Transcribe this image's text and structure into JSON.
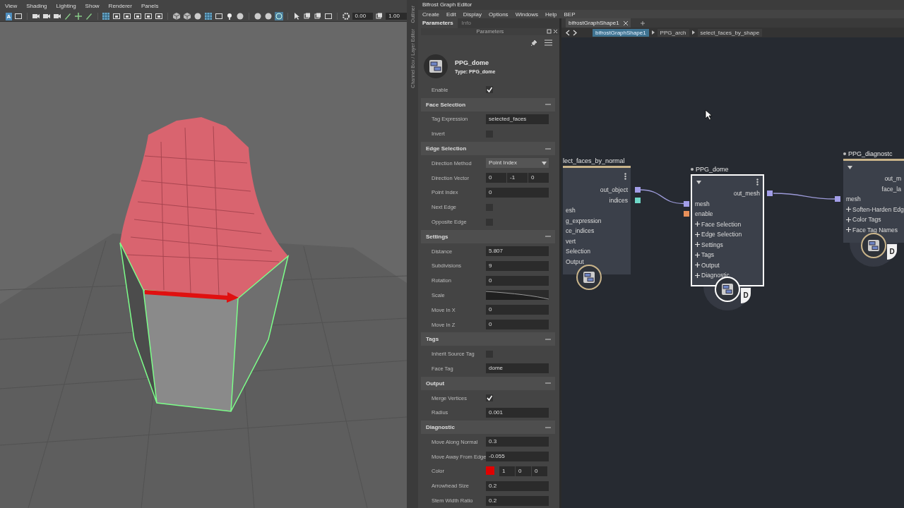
{
  "viewport": {
    "menu": [
      "View",
      "Shading",
      "Lighting",
      "Show",
      "Renderer",
      "Panels"
    ],
    "select_label": "A",
    "toolbar_fields": [
      {
        "value": "0.00"
      },
      {
        "value": "1.00"
      }
    ],
    "picture": {
      "kind": "picture"
    }
  },
  "side_tabs": [
    "Outliner",
    "Channel Box / Layer Editor"
  ],
  "editor": {
    "title": "Bifrost Graph Editor",
    "menu": [
      "Create",
      "Edit",
      "Display",
      "Options",
      "Windows",
      "Help",
      "BEP"
    ],
    "parameters_panel": {
      "tabs": [
        {
          "label": "Parameters",
          "selected": true
        },
        {
          "label": "Info",
          "selected": false
        }
      ],
      "header": "Parameters",
      "node_name": "PPG_dome",
      "node_type": "Type: PPG_dome",
      "rows": [
        {
          "kind": "checkbox",
          "label": "Enable",
          "checked": true
        },
        {
          "kind": "section",
          "label": "Face Selection",
          "expanded": true
        },
        {
          "kind": "text",
          "label": "Tag Expression",
          "value": "selected_faces"
        },
        {
          "kind": "checkbox",
          "label": "Invert",
          "checked": false
        },
        {
          "kind": "section",
          "label": "Edge Selection",
          "expanded": true
        },
        {
          "kind": "dropdown",
          "label": "Direction Method",
          "value": "Point Index"
        },
        {
          "kind": "vector",
          "label": "Direction Vector",
          "values": [
            "0",
            "-1",
            "0"
          ]
        },
        {
          "kind": "text",
          "label": "Point Index",
          "value": "0"
        },
        {
          "kind": "checkbox",
          "label": "Next Edge",
          "checked": false
        },
        {
          "kind": "checkbox",
          "label": "Opposite Edge",
          "checked": false
        },
        {
          "kind": "section",
          "label": "Settings",
          "expanded": true
        },
        {
          "kind": "text",
          "label": "Distance",
          "value": "5.807"
        },
        {
          "kind": "text",
          "label": "Subdivisions",
          "value": "9"
        },
        {
          "kind": "text",
          "label": "Rotation",
          "value": "0"
        },
        {
          "kind": "ramp",
          "label": "Scale"
        },
        {
          "kind": "text",
          "label": "Move In X",
          "value": "0"
        },
        {
          "kind": "text",
          "label": "Move In Z",
          "value": "0"
        },
        {
          "kind": "section",
          "label": "Tags",
          "expanded": true
        },
        {
          "kind": "checkbox",
          "label": "Inherit Source Tag",
          "checked": false
        },
        {
          "kind": "text",
          "label": "Face Tag",
          "value": "dome"
        },
        {
          "kind": "section",
          "label": "Output",
          "expanded": true
        },
        {
          "kind": "checkbox",
          "label": "Merge Vertices",
          "checked": true
        },
        {
          "kind": "text",
          "label": "Radius",
          "value": "0.001"
        },
        {
          "kind": "section",
          "label": "Diagnostic",
          "expanded": true
        },
        {
          "kind": "text",
          "label": "Move Along Normal",
          "value": "0.3"
        },
        {
          "kind": "text",
          "label": "Move Away From Edge",
          "value": "-0.055"
        },
        {
          "kind": "color",
          "label": "Color",
          "color": "#e00000",
          "values": [
            "1",
            "0",
            "0"
          ]
        },
        {
          "kind": "text",
          "label": "Arrowhead Size",
          "value": "0.2"
        },
        {
          "kind": "text",
          "label": "Stem Width Ratio",
          "value": "0.2"
        }
      ]
    },
    "graph": {
      "tabs": [
        {
          "label": "bifrostGraphShape1",
          "selected": true
        }
      ],
      "breadcrumbs": [
        {
          "label": "bifrostGraphShape1",
          "selected": true
        },
        {
          "label": "PPG_arch",
          "selected": false
        },
        {
          "label": "select_faces_by_shape",
          "selected": false
        }
      ],
      "nodes": [
        {
          "title": "lect_faces_by_normal",
          "title_dot": false,
          "selected": false,
          "collapse_arrow": false,
          "menu": true,
          "outputs": [
            {
              "name": "out_object",
              "color": "#a29ee8"
            },
            {
              "name": "indices",
              "color": "#6fd8c8"
            }
          ],
          "inputs": [
            {
              "kind": "plain",
              "name": "esh"
            },
            {
              "kind": "plain",
              "name": "g_expression"
            },
            {
              "kind": "plain",
              "name": "ce_indices"
            },
            {
              "kind": "plain",
              "name": "vert"
            },
            {
              "kind": "plain",
              "name": "Selection"
            },
            {
              "kind": "plain",
              "name": "Output"
            }
          ]
        },
        {
          "title": "PPG_dome",
          "title_dot": true,
          "selected": true,
          "collapse_arrow": true,
          "menu": true,
          "badge": "D",
          "outputs": [
            {
              "name": "out_mesh",
              "color": "#a29ee8"
            }
          ],
          "inputs": [
            {
              "kind": "port",
              "name": "mesh",
              "color": "#a29ee8"
            },
            {
              "kind": "port",
              "name": "enable",
              "color": "#e8905a"
            },
            {
              "kind": "group",
              "name": "Face Selection"
            },
            {
              "kind": "group",
              "name": "Edge Selection"
            },
            {
              "kind": "group",
              "name": "Settings"
            },
            {
              "kind": "group",
              "name": "Tags"
            },
            {
              "kind": "group",
              "name": "Output"
            },
            {
              "kind": "group",
              "name": "Diagnostic"
            }
          ]
        },
        {
          "title": "PPG_diagnostc",
          "title_dot": true,
          "selected": false,
          "collapse_arrow": true,
          "menu": false,
          "badge": "D",
          "outputs": [
            {
              "name": "out_m"
            },
            {
              "name": "face_la"
            }
          ],
          "inputs": [
            {
              "kind": "port",
              "name": "mesh",
              "color": "#a29ee8"
            },
            {
              "kind": "group",
              "name": "Soften-Harden Edg"
            },
            {
              "kind": "group",
              "name": "Color Tags"
            },
            {
              "kind": "group",
              "name": "Face Tag Names"
            }
          ]
        }
      ]
    }
  }
}
